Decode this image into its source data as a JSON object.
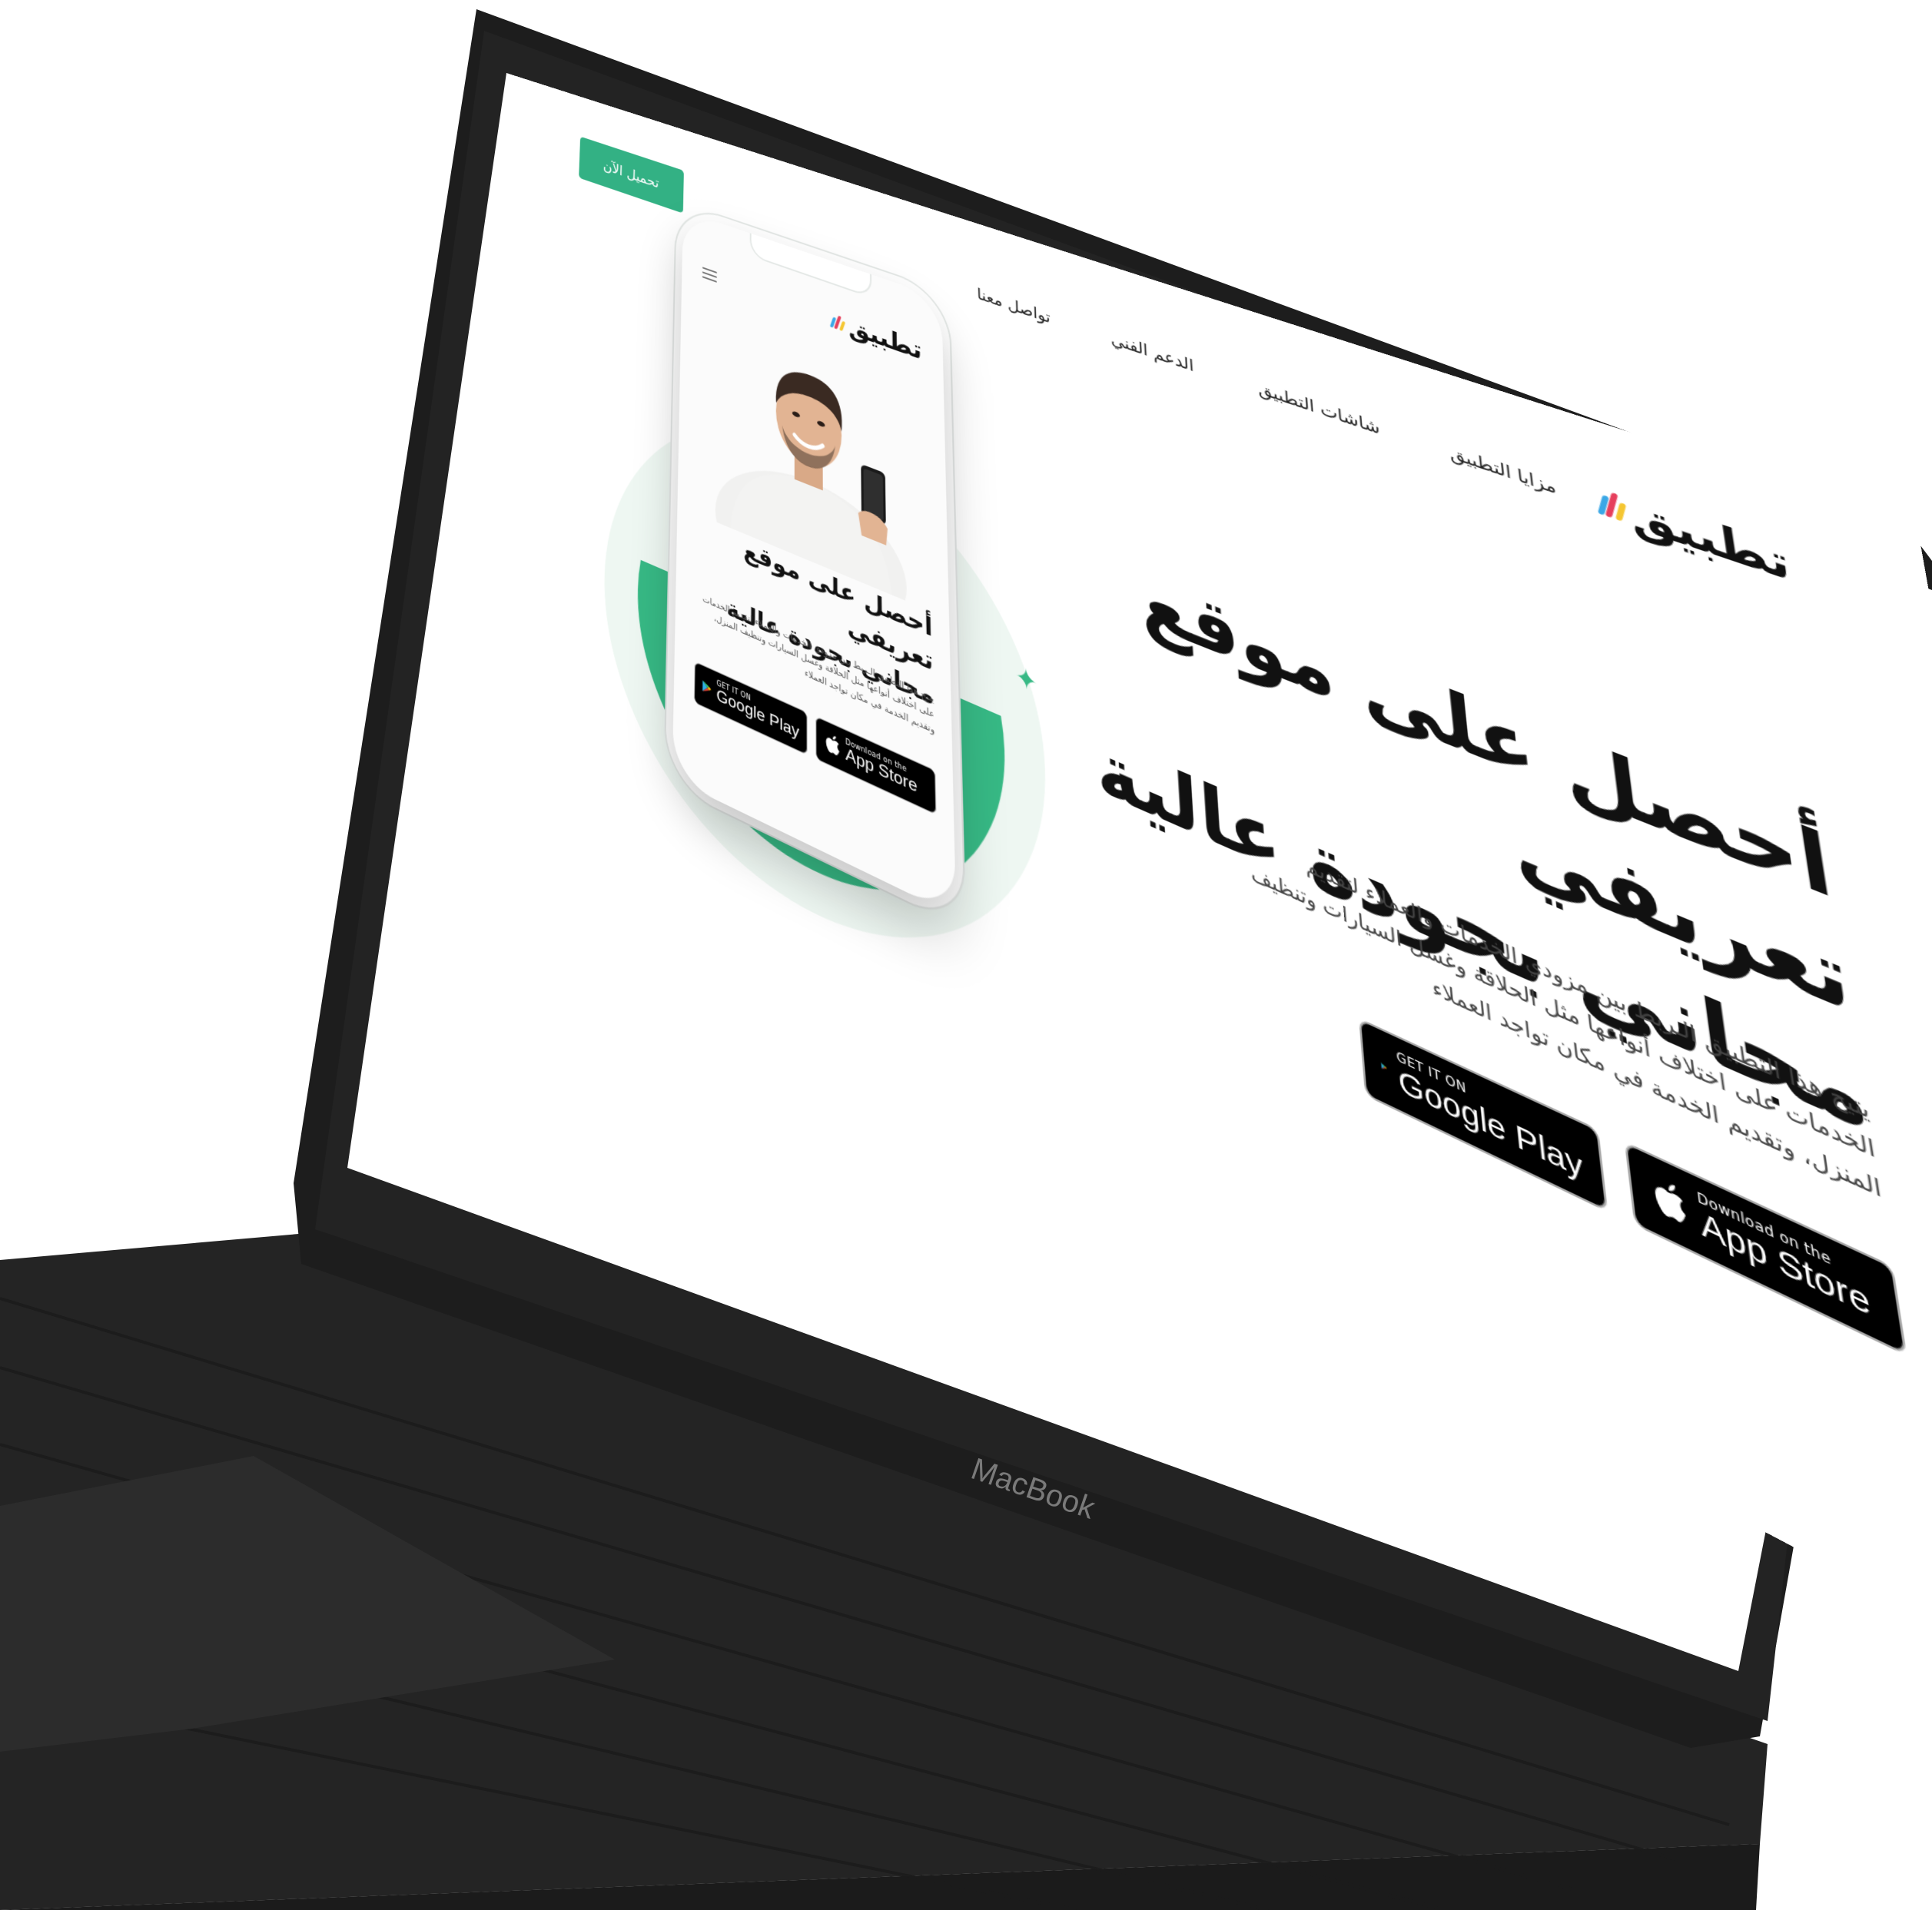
{
  "device": {
    "brand_label": "MacBook"
  },
  "site": {
    "logo_text": "تطبيق",
    "nav": [
      "مزايا التطبيق",
      "شاشات التطبيق",
      "الدعم الفني",
      "تواصل معنا"
    ],
    "cta_label": "تحميل الآن",
    "hero": {
      "title_line1": "أحصل على موقع تعريفي",
      "title_line2": "مجاني بجودة عالية",
      "description": "يتيح هذا التطبيق الـربط بين مزودي الخدمات والعملاء لتقديم الخدمات على اختلاف أنواعها مثل الحلاقة وغسل السيارات وتنظيف المنزل، وتقديم الخدمة في مكان تواجد العملاء"
    },
    "google_play": {
      "small": "GET IT ON",
      "big": "Google Play"
    },
    "app_store": {
      "small": "Download on the",
      "big": "App Store"
    }
  },
  "colors": {
    "accent": "#33b184",
    "laptop_body": "#262626",
    "logo_mark": [
      "#f5c631",
      "#e63f5c",
      "#3aa7e6"
    ]
  },
  "icons": [
    "logo-mark-icon",
    "google-play-icon",
    "apple-icon",
    "menu-icon",
    "sparkle-icon"
  ]
}
